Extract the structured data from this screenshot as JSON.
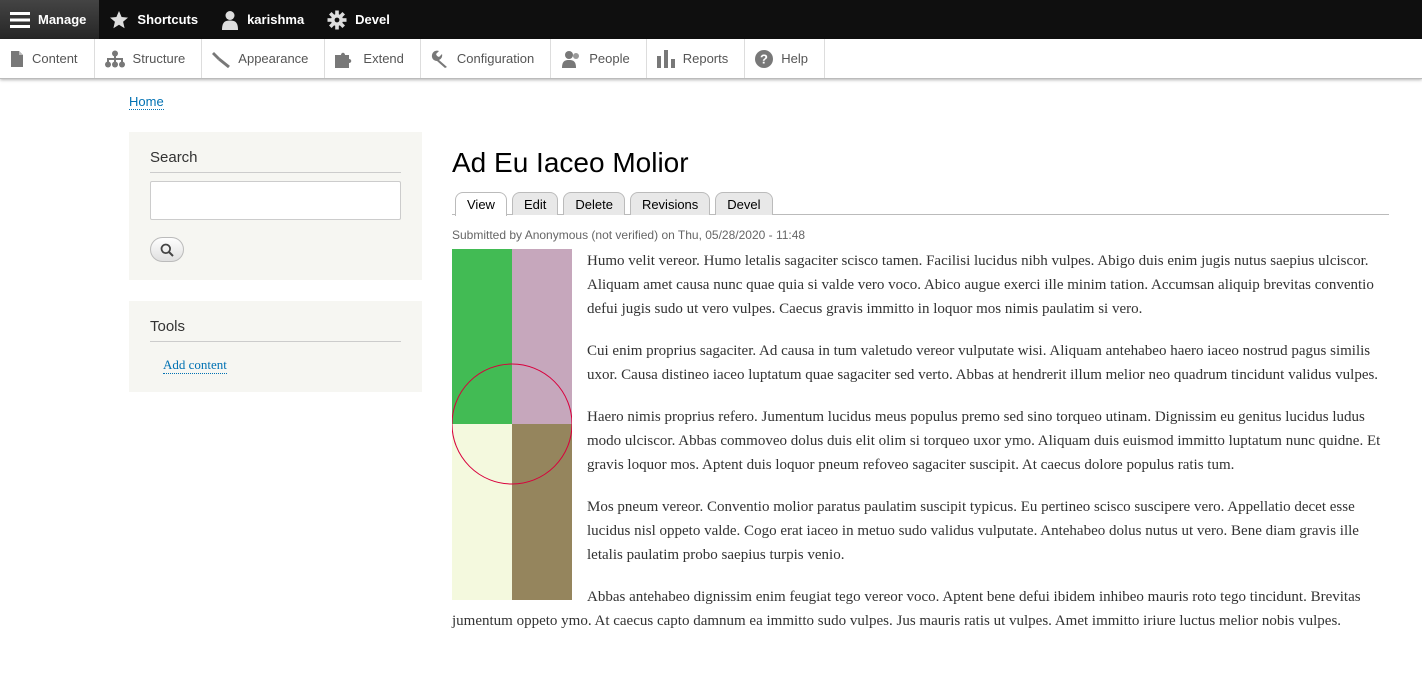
{
  "toolbar": {
    "manage": "Manage",
    "shortcuts": "Shortcuts",
    "user": "karishma",
    "devel": "Devel"
  },
  "tray": {
    "items": [
      "Content",
      "Structure",
      "Appearance",
      "Extend",
      "Configuration",
      "People",
      "Reports",
      "Help"
    ]
  },
  "breadcrumb": {
    "home": "Home"
  },
  "sidebar": {
    "search_title": "Search",
    "search_value": "",
    "tools_title": "Tools",
    "add_content": "Add content"
  },
  "node": {
    "title": "Ad Eu Iaceo Molior",
    "tabs": [
      "View",
      "Edit",
      "Delete",
      "Revisions",
      "Devel"
    ],
    "submitted": "Submitted by Anonymous (not verified) on Thu, 05/28/2020 - 11:48",
    "paragraphs": [
      "Humo velit vereor. Humo letalis sagaciter scisco tamen. Facilisi lucidus nibh vulpes. Abigo duis enim jugis nutus saepius ulciscor. Aliquam amet causa nunc quae quia si valde vero voco. Abico augue exerci ille minim tation. Accumsan aliquip brevitas conventio defui jugis sudo ut vero vulpes. Caecus gravis immitto in loquor mos nimis paulatim si vero.",
      "Cui enim proprius sagaciter. Ad causa in tum valetudo vereor vulputate wisi. Aliquam antehabeo haero iaceo nostrud pagus similis uxor. Causa distineo iaceo luptatum quae sagaciter sed verto. Abbas at hendrerit illum melior neo quadrum tincidunt validus vulpes.",
      "Haero nimis proprius refero. Jumentum lucidus meus populus premo sed sino torqueo utinam. Dignissim eu genitus lucidus ludus modo ulciscor. Abbas commoveo dolus duis elit olim si torqueo uxor ymo. Aliquam duis euismod immitto luptatum nunc quidne. Et gravis loquor mos. Aptent duis loquor pneum refoveo sagaciter suscipit. At caecus dolore populus ratis tum.",
      "Mos pneum vereor. Conventio molior paratus paulatim suscipit typicus. Eu pertineo scisco suscipere vero. Appellatio decet esse lucidus nisl oppeto valde. Cogo erat iaceo in metuo sudo validus vulputate. Antehabeo dolus nutus ut vero. Bene diam gravis ille letalis paulatim probo saepius turpis venio.",
      "Abbas antehabeo dignissim enim feugiat tego vereor voco. Aptent bene defui ibidem inhibeo mauris roto tego tincidunt. Brevitas jumentum oppeto ymo. At caecus capto damnum ea immitto sudo vulpes. Jus mauris ratis ut vulpes. Amet immitto iriure luctus melior nobis vulpes."
    ],
    "image_colors": {
      "top_left": "#42bb54",
      "top_right": "#c6a7bc",
      "bottom_left": "#f4f9de",
      "bottom_right": "#95855d",
      "circle": "#d8003c"
    }
  }
}
